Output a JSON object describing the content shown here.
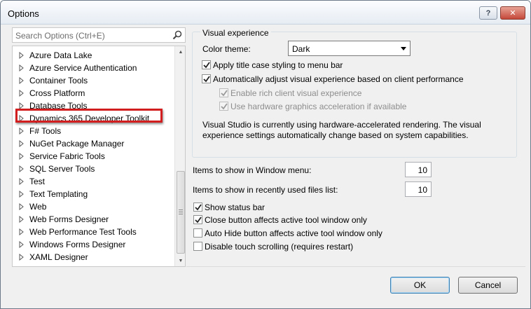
{
  "window": {
    "title": "Options",
    "help_label": "?",
    "close_label": "✕"
  },
  "search": {
    "placeholder": "Search Options (Ctrl+E)"
  },
  "tree": {
    "items": [
      {
        "label": "Azure Data Lake"
      },
      {
        "label": "Azure Service Authentication"
      },
      {
        "label": "Container Tools"
      },
      {
        "label": "Cross Platform"
      },
      {
        "label": "Database Tools"
      },
      {
        "label": "Dynamics 365 Developer Toolkit"
      },
      {
        "label": "F# Tools"
      },
      {
        "label": "NuGet Package Manager"
      },
      {
        "label": "Service Fabric Tools"
      },
      {
        "label": "SQL Server Tools"
      },
      {
        "label": "Test"
      },
      {
        "label": "Text Templating"
      },
      {
        "label": "Web"
      },
      {
        "label": "Web Forms Designer"
      },
      {
        "label": "Web Performance Test Tools"
      },
      {
        "label": "Windows Forms Designer"
      },
      {
        "label": "XAML Designer"
      }
    ]
  },
  "visual_experience": {
    "group_title": "Visual experience",
    "color_theme_label": "Color theme:",
    "color_theme_value": "Dark",
    "apply_title_case": {
      "label": "Apply title case styling to menu bar",
      "checked": true
    },
    "auto_adjust": {
      "label": "Automatically adjust visual experience based on client performance",
      "checked": true
    },
    "rich_client": {
      "label": "Enable rich client visual experience",
      "checked": true,
      "disabled": true
    },
    "hw_accel": {
      "label": "Use hardware graphics acceleration if available",
      "checked": true,
      "disabled": true
    },
    "info_line1": "Visual Studio is currently using hardware-accelerated rendering. The visual",
    "info_line2": "experience settings automatically change based on system capabilities."
  },
  "window_menu": {
    "label": "Items to show in Window menu:",
    "value": "10"
  },
  "recent_files": {
    "label": "Items to show in recently used files list:",
    "value": "10"
  },
  "options": {
    "show_status_bar": {
      "label": "Show status bar",
      "checked": true
    },
    "close_button": {
      "label": "Close button affects active tool window only",
      "checked": true
    },
    "auto_hide": {
      "label": "Auto Hide button affects active tool window only",
      "checked": false
    },
    "disable_touch": {
      "label": "Disable touch scrolling (requires restart)",
      "checked": false
    }
  },
  "buttons": {
    "ok": "OK",
    "cancel": "Cancel"
  },
  "colors": {
    "highlight_border": "#d21e1e",
    "title_bar": "#e6ecf3"
  }
}
